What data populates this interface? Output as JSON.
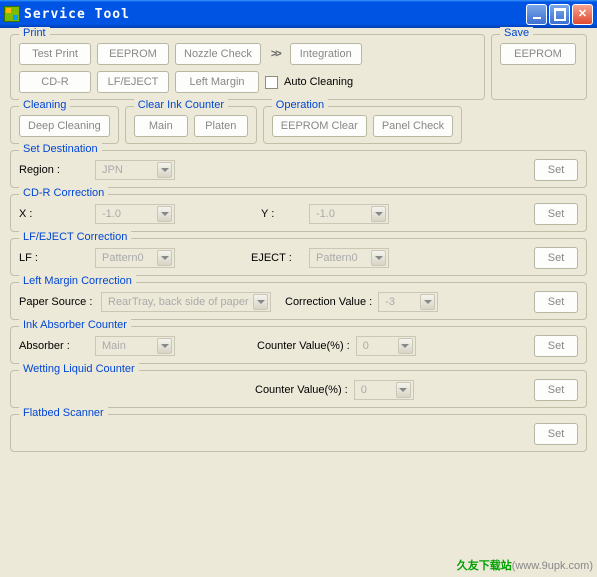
{
  "title": "Service Tool",
  "print": {
    "legend": "Print",
    "testPrint": "Test Print",
    "eeprom": "EEPROM",
    "nozzleCheck": "Nozzle Check",
    "integration": "Integration",
    "cdr": "CD-R",
    "lfEject": "LF/EJECT",
    "leftMargin": "Left Margin",
    "autoCleaning": "Auto Cleaning"
  },
  "save": {
    "legend": "Save",
    "eeprom": "EEPROM"
  },
  "cleaning": {
    "legend": "Cleaning",
    "deep": "Deep Cleaning"
  },
  "clearInk": {
    "legend": "Clear Ink Counter",
    "main": "Main",
    "platen": "Platen"
  },
  "operation": {
    "legend": "Operation",
    "eepromClear": "EEPROM Clear",
    "panelCheck": "Panel Check"
  },
  "setDest": {
    "legend": "Set Destination",
    "regionLabel": "Region :",
    "regionValue": "JPN",
    "set": "Set"
  },
  "cdrCorr": {
    "legend": "CD-R Correction",
    "xLabel": "X :",
    "xValue": "-1.0",
    "yLabel": "Y :",
    "yValue": "-1.0",
    "set": "Set"
  },
  "lfEjectCorr": {
    "legend": "LF/EJECT Correction",
    "lfLabel": "LF :",
    "lfValue": "Pattern0",
    "ejectLabel": "EJECT :",
    "ejectValue": "Pattern0",
    "set": "Set"
  },
  "leftMarginCorr": {
    "legend": "Left Margin Correction",
    "paperSourceLabel": "Paper Source :",
    "paperSourceValue": "RearTray, back side of paper",
    "corrValLabel": "Correction Value :",
    "corrVal": "-3",
    "set": "Set"
  },
  "inkAbs": {
    "legend": "Ink Absorber Counter",
    "absorberLabel": "Absorber :",
    "absorberValue": "Main",
    "counterLabel": "Counter Value(%) :",
    "counterValue": "0",
    "set": "Set"
  },
  "wetting": {
    "legend": "Wetting Liquid Counter",
    "counterLabel": "Counter Value(%) :",
    "counterValue": "0",
    "set": "Set"
  },
  "flatbed": {
    "legend": "Flatbed Scanner",
    "set": "Set"
  },
  "watermark": {
    "site": "久友下载站",
    "url": "(www.9upk.com)"
  }
}
